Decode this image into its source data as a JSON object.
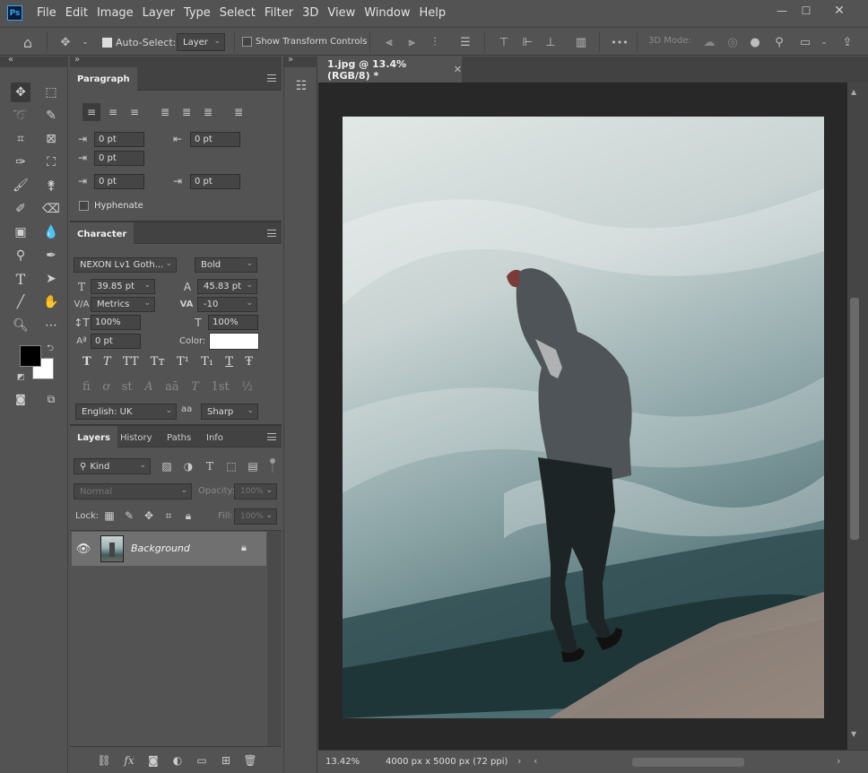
{
  "app": {
    "logo": "Ps"
  },
  "menu": [
    "File",
    "Edit",
    "Image",
    "Layer",
    "Type",
    "Select",
    "Filter",
    "3D",
    "View",
    "Window",
    "Help"
  ],
  "window_controls": {
    "minimize": "—",
    "maximize": "☐",
    "close": "✕"
  },
  "options_bar": {
    "auto_select_label": "Auto-Select:",
    "auto_select_value": "Layer",
    "show_transform_label": "Show Transform Controls",
    "mode_3d_label": "3D Mode:",
    "more": "•••"
  },
  "document": {
    "tab_title": "1.jpg @ 13.4% (RGB/8) *",
    "zoom": "13.42%",
    "dimensions": "4000 px x 5000 px (72 ppi)"
  },
  "paragraph": {
    "tab": "Paragraph",
    "indent_left": "0 pt",
    "indent_right": "0 pt",
    "first_line": "0 pt",
    "space_before": "0 pt",
    "space_after": "0 pt",
    "hyphenate_label": "Hyphenate"
  },
  "character": {
    "tab": "Character",
    "font_family": "NEXON Lv1 Goth...",
    "font_style": "Bold",
    "font_size": "39.85 pt",
    "leading": "45.83 pt",
    "kerning": "Metrics",
    "tracking": "-10",
    "vertical_scale": "100%",
    "horizontal_scale": "100%",
    "baseline_shift": "0 pt",
    "color_label": "Color:",
    "language": "English: UK",
    "antialias": "Sharp",
    "aa_label": "aa",
    "style_buttons": [
      "T",
      "T",
      "TT",
      "Tт",
      "T¹",
      "T₁",
      "T",
      "Ŧ"
    ],
    "opentype_buttons": [
      "fi",
      "ơ",
      "st",
      "A",
      "aā",
      "T",
      "1st",
      "½"
    ]
  },
  "layers": {
    "tabs": [
      "Layers",
      "History",
      "Paths",
      "Info"
    ],
    "filter_kind": "Kind",
    "blend_mode": "Normal",
    "opacity_label": "Opacity:",
    "opacity": "100%",
    "lock_label": "Lock:",
    "fill_label": "Fill:",
    "fill": "100%",
    "items": [
      {
        "name": "Background",
        "visible": true,
        "locked": true
      }
    ]
  },
  "colors": {
    "foreground": "#000000",
    "background": "#ffffff",
    "accent": "#31a8ff"
  }
}
